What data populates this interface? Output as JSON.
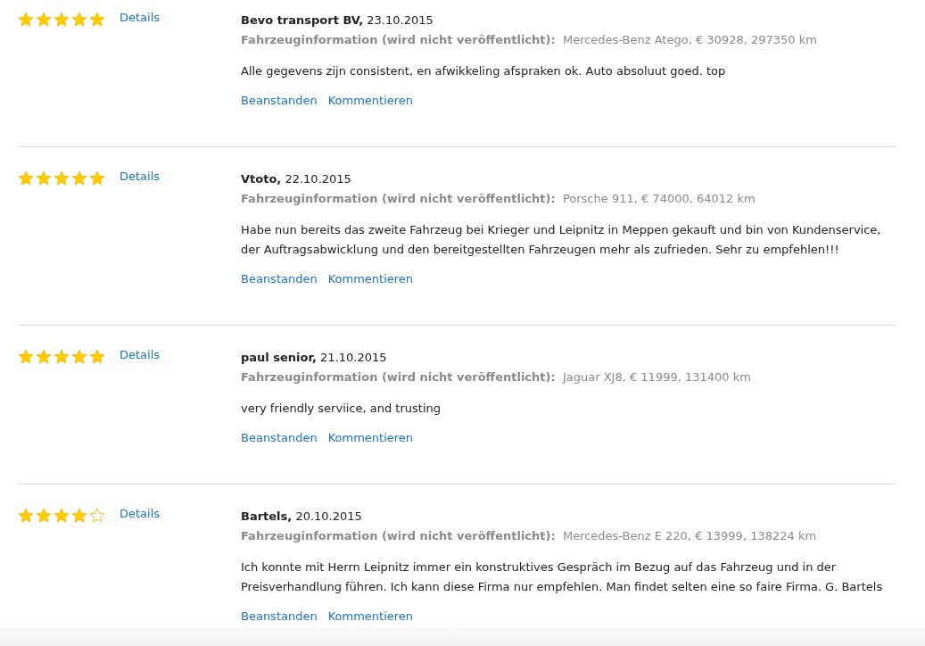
{
  "reviews": [
    {
      "stars": 5,
      "details_link": "Details",
      "author": "**Bevo transport BV,** 23.10.2015",
      "vehicle_info": "**Fahrzeuginformation (wird nicht veröffentlicht):**  Mercedes-Benz Atego, € 30928, 297350 km",
      "text": "Alle gegevens zijn consistent, en afwikkeling afspraken ok. Auto absoluut goed. top",
      "actions": [
        "Beanstanden",
        "Kommentieren"
      ]
    },
    {
      "stars": 5,
      "details_link": "Details",
      "author": "**Vtoto,** 22.10.2015",
      "vehicle_info": "**Fahrzeuginformation (wird nicht veröffentlicht):**  Porsche 911, € 74000, 64012 km",
      "text": "Habe nun bereits das zweite Fahrzeug bei Krieger und Leipnitz in Meppen gekauft und bin von Kundenservice, der Auftragsabwicklung und den bereitgestellten Fahrzeugen mehr als zufrieden. Sehr zu empfehlen!!!",
      "actions": [
        "Beanstanden",
        "Kommentieren"
      ]
    },
    {
      "stars": 5,
      "details_link": "Details",
      "author": "**paul senior,** 21.10.2015",
      "vehicle_info": "**Fahrzeuginformation (wird nicht veröffentlicht):**  Jaguar XJ8, € 11999, 131400 km",
      "text": "very friendly serviice, and trusting",
      "actions": [
        "Beanstanden",
        "Kommentieren"
      ]
    },
    {
      "stars": 4,
      "details_link": "Details",
      "author": "**Bartels,** 20.10.2015",
      "vehicle_info": "**Fahrzeuginformation (wird nicht veröffentlicht):**  Mercedes-Benz E 220, € 13999, 138224 km",
      "text": "Ich konnte mit Herrn Leipnitz immer ein konstruktives Gespräch im Bezug auf das Fahrzeug und in der Preisverhandlung führen. Ich kann diese Firma nur empfehlen. Man findet selten eine so faire Firma. G. Bartels",
      "actions": [
        "Beanstanden",
        "Kommentieren"
      ]
    }
  ]
}
